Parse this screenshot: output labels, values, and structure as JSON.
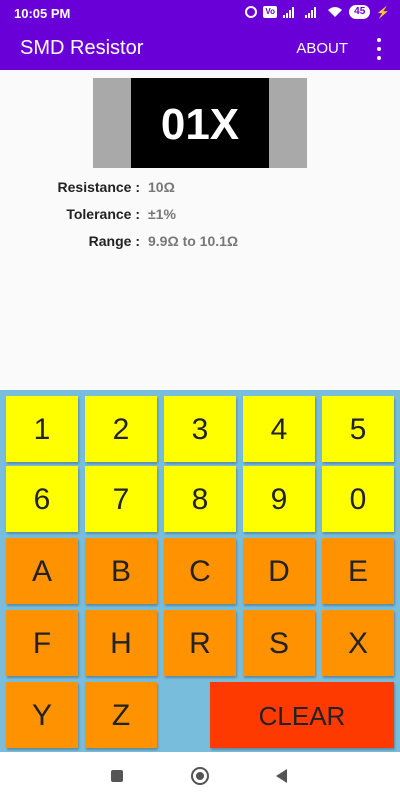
{
  "status_bar": {
    "time": "10:05 PM",
    "battery": "45",
    "icons": [
      "alarm-icon",
      "volte-icon",
      "signal-icon",
      "signal-icon",
      "wifi-icon",
      "battery-icon",
      "charging-icon"
    ]
  },
  "app_bar": {
    "title": "SMD Resistor",
    "about_label": "ABOUT",
    "menu_icon": "more-vert-icon"
  },
  "resistor": {
    "code": "01X"
  },
  "info": {
    "resistance_label": "Resistance :",
    "resistance_value": "10Ω",
    "tolerance_label": "Tolerance :",
    "tolerance_value": "±1%",
    "range_label": "Range :",
    "range_value": "9.9Ω to 10.1Ω"
  },
  "keypad": {
    "digits": [
      "1",
      "2",
      "3",
      "4",
      "5",
      "6",
      "7",
      "8",
      "9",
      "0"
    ],
    "letters": [
      "A",
      "B",
      "C",
      "D",
      "E",
      "F",
      "H",
      "R",
      "S",
      "X",
      "Y",
      "Z"
    ],
    "clear_label": "CLEAR"
  },
  "colors": {
    "primary": "#6a00d8",
    "keypad_bg": "#79bddc",
    "digit_key": "#ffff00",
    "letter_key": "#ff9200",
    "clear_key": "#ff3a00"
  }
}
